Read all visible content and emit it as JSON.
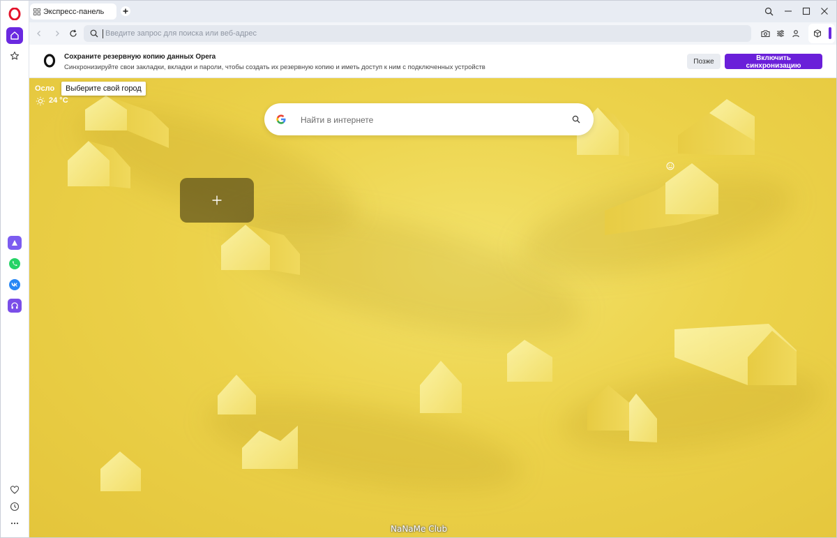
{
  "tab": {
    "title": "Экспресс-панель"
  },
  "address_bar": {
    "placeholder": "Введите запрос для поиска или веб-адрес"
  },
  "sync_banner": {
    "title": "Сохраните резервную копию данных Opera",
    "text": "Синхронизируйте свои закладки, вкладки и пароли, чтобы создать их резервную копию и иметь доступ к ним с подключенных устройств",
    "later_label": "Позже",
    "enable_label": "Включить синхронизацию"
  },
  "weather": {
    "city": "Осло",
    "temperature": "24 °C",
    "tooltip": "Выберите свой город"
  },
  "search": {
    "placeholder": "Найти в интернете"
  },
  "sidebar": {
    "top_items": [
      "opera-logo-icon",
      "home-icon",
      "bookmarks-star-icon"
    ],
    "apps": [
      "aria-icon",
      "whatsapp-icon",
      "vk-icon",
      "player-icon"
    ],
    "bottom_items": [
      "heart-icon",
      "history-clock-icon",
      "more-dots-icon"
    ]
  },
  "colors": {
    "accent": "#6a29e0",
    "sync_button": "#6a1fd9",
    "background_yellow": "#ecd24a"
  },
  "watermark": "NaNaMe Club"
}
